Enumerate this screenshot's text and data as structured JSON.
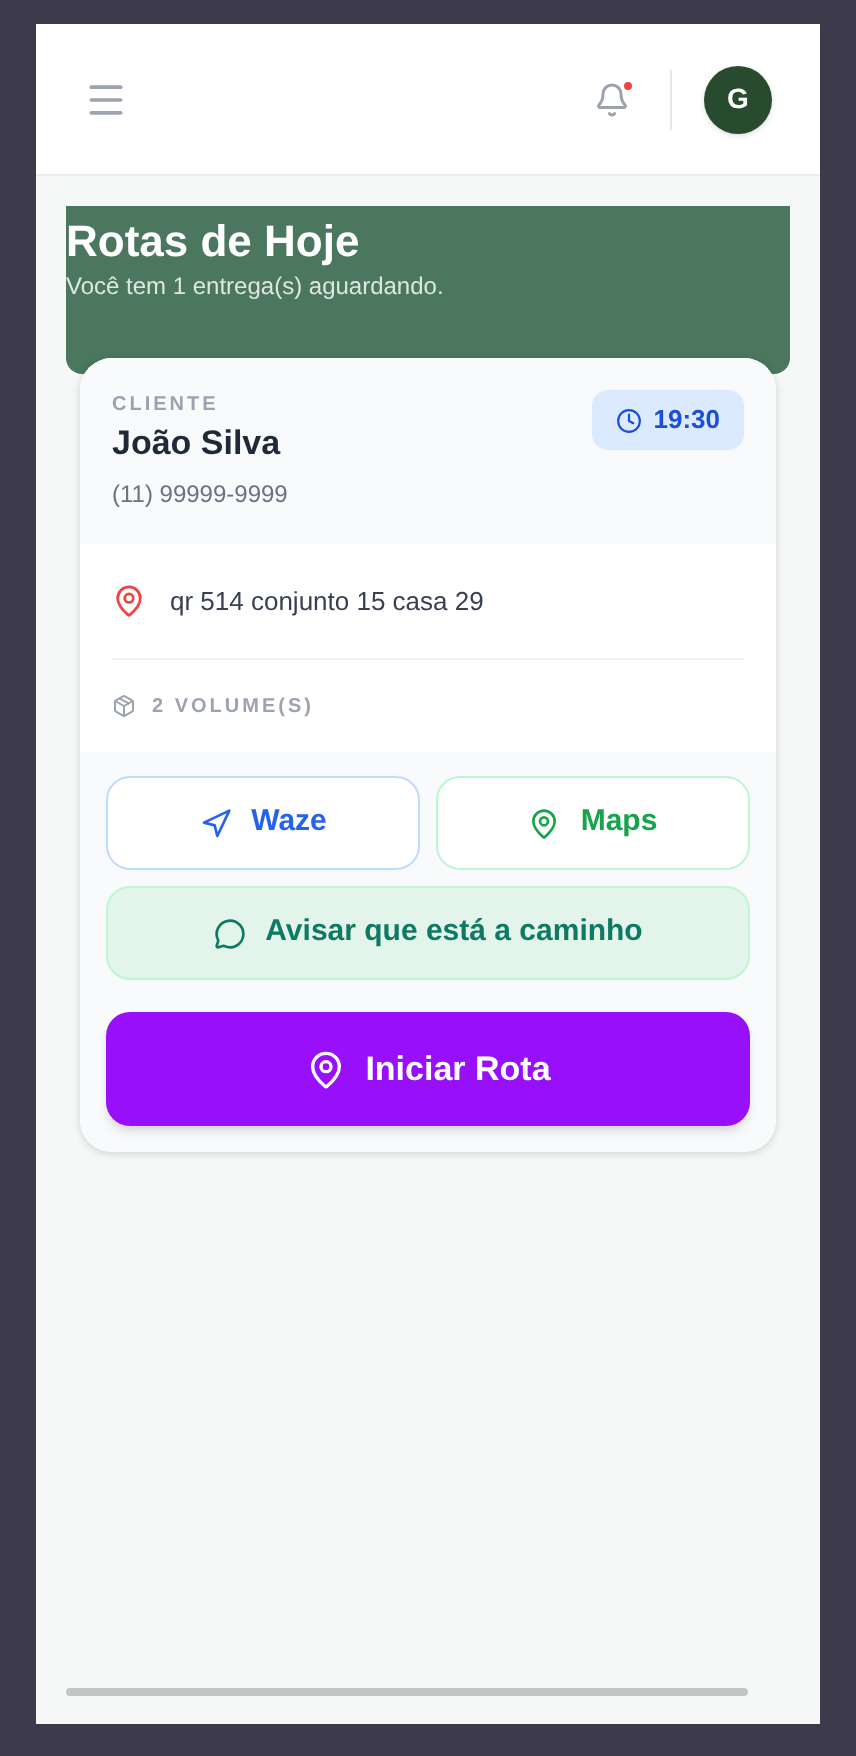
{
  "header": {
    "notification_unread": true,
    "avatar_letter": "G"
  },
  "banner": {
    "title": "Rotas de Hoje",
    "subtitle": "Você tem 1 entrega(s) aguardando."
  },
  "delivery": {
    "client_label": "CLIENTE",
    "client_name": "João Silva",
    "phone": "(11) 99999-9999",
    "time": "19:30",
    "address": "qr 514 conjunto 15 casa 29",
    "volumes": "2 VOLUME(S)",
    "actions": [
      {
        "kind": "waze",
        "label": "Waze"
      },
      {
        "kind": "maps",
        "label": "Maps"
      },
      {
        "kind": "notify",
        "label": "Avisar que está a caminho"
      },
      {
        "kind": "start",
        "label": "Iniciar Rota"
      }
    ]
  }
}
